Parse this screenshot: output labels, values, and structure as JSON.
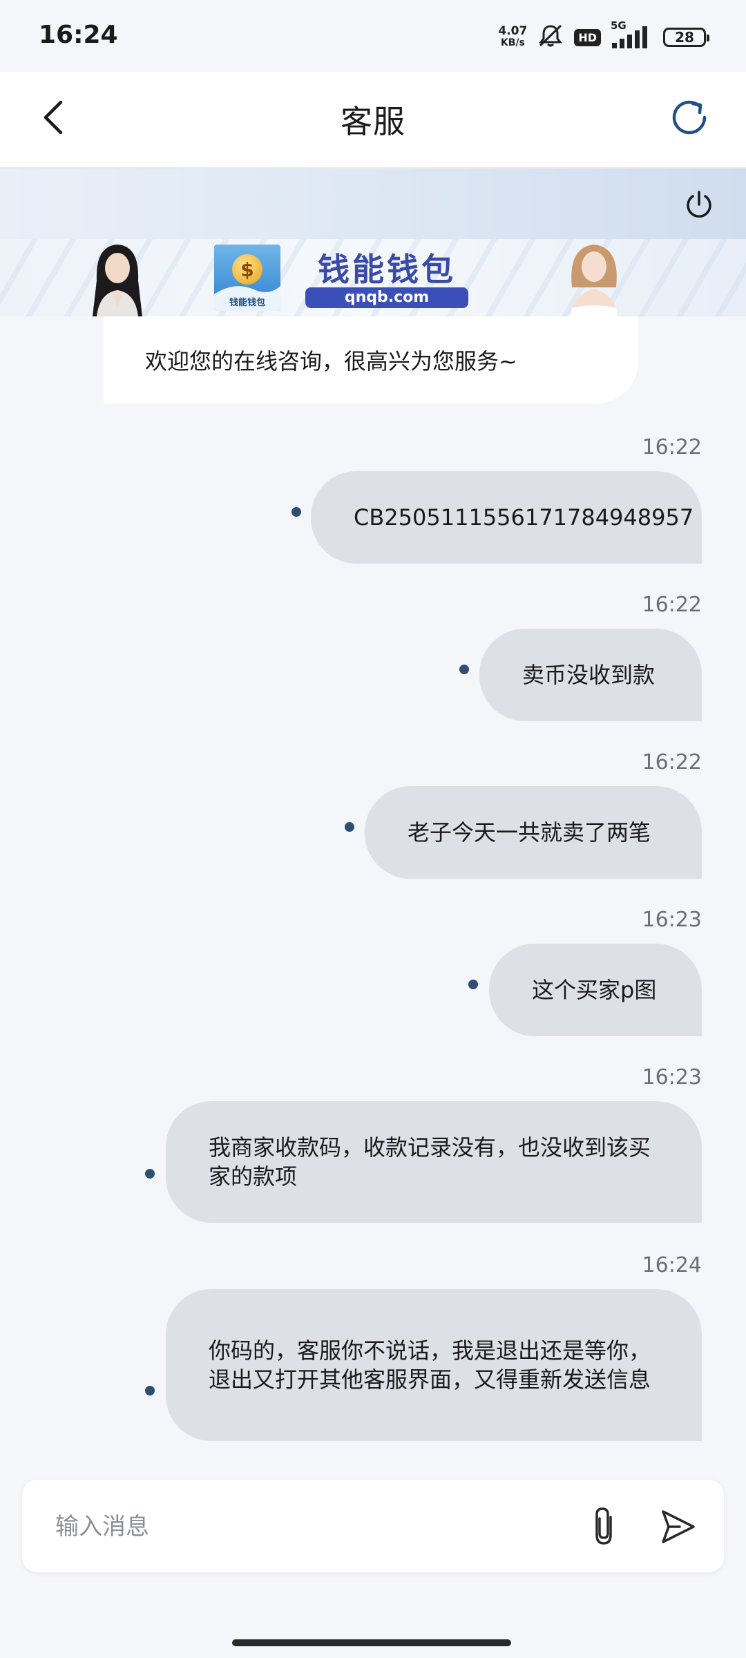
{
  "status_bar": {
    "time": "16:24",
    "net_speed_value": "4.07",
    "net_speed_unit": "KB/s",
    "hd": "HD",
    "network": "5G",
    "battery": "28"
  },
  "header": {
    "title": "客服"
  },
  "banner": {
    "brand": "钱能钱包",
    "url": "qnqb.com",
    "logo_text": "钱能钱包",
    "logo_symbol": "$"
  },
  "chat": {
    "welcome": "欢迎您的在线咨询，很高兴为您服务~",
    "messages": [
      {
        "time": "16:22",
        "text": "CB2505111556171784948957"
      },
      {
        "time": "16:22",
        "text": "卖币没收到款"
      },
      {
        "time": "16:22",
        "text": "老子今天一共就卖了两笔"
      },
      {
        "time": "16:23",
        "text": "这个买家p图"
      },
      {
        "time": "16:23",
        "text": "我商家收款码，收款记录没有，也没收到该买家的款项"
      },
      {
        "time": "16:24",
        "text": "你码的，客服你不说话，我是退出还是等你，退出又打开其他客服界面，又得重新发送信息"
      }
    ]
  },
  "input": {
    "placeholder": "输入消息"
  },
  "colors": {
    "bubble": "#dde1e7",
    "status_dot": "#2e4f73",
    "background": "#f4f6f9",
    "brand_blue": "#3a4fb8"
  }
}
